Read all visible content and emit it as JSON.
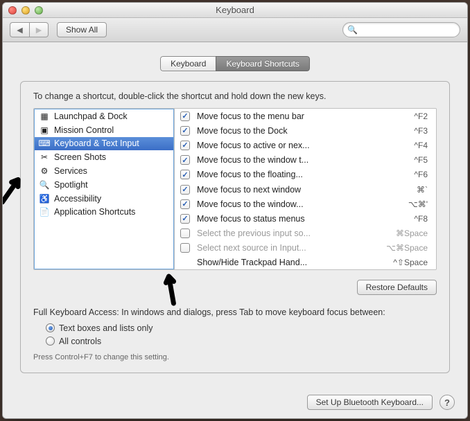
{
  "window": {
    "title": "Keyboard"
  },
  "toolbar": {
    "show_all": "Show All",
    "search_placeholder": ""
  },
  "tabs": {
    "keyboard": "Keyboard",
    "shortcuts": "Keyboard Shortcuts"
  },
  "instruction": "To change a shortcut, double-click the shortcut and hold down the new keys.",
  "categories": [
    {
      "label": "Launchpad & Dock",
      "icon": "launchpad-icon",
      "sel": false
    },
    {
      "label": "Mission Control",
      "icon": "mission-control-icon",
      "sel": false
    },
    {
      "label": "Keyboard & Text Input",
      "icon": "keyboard-icon",
      "sel": true
    },
    {
      "label": "Screen Shots",
      "icon": "screenshots-icon",
      "sel": false
    },
    {
      "label": "Services",
      "icon": "services-icon",
      "sel": false
    },
    {
      "label": "Spotlight",
      "icon": "spotlight-icon",
      "sel": false
    },
    {
      "label": "Accessibility",
      "icon": "accessibility-icon",
      "sel": false
    },
    {
      "label": "Application Shortcuts",
      "icon": "app-shortcuts-icon",
      "sel": false
    }
  ],
  "shortcuts": [
    {
      "on": true,
      "label": "Move focus to the menu bar",
      "keys": "^F2"
    },
    {
      "on": true,
      "label": "Move focus to the Dock",
      "keys": "^F3"
    },
    {
      "on": true,
      "label": "Move focus to active or nex...",
      "keys": "^F4"
    },
    {
      "on": true,
      "label": "Move focus to the window t...",
      "keys": "^F5"
    },
    {
      "on": true,
      "label": "Move focus to the floating...",
      "keys": "^F6"
    },
    {
      "on": true,
      "label": "Move focus to next window",
      "keys": "⌘`"
    },
    {
      "on": true,
      "label": "Move focus to the window...",
      "keys": "⌥⌘'"
    },
    {
      "on": true,
      "label": "Move focus to status menus",
      "keys": "^F8"
    },
    {
      "on": false,
      "label": "Select the previous input so...",
      "keys": "⌘Space",
      "disabled": true
    },
    {
      "on": false,
      "label": "Select next source in Input...",
      "keys": "⌥⌘Space",
      "disabled": true
    },
    {
      "on": null,
      "label": "Show/Hide Trackpad Hand...",
      "keys": "^⇧Space"
    }
  ],
  "restore_defaults": "Restore Defaults",
  "fka": {
    "text": "Full Keyboard Access: In windows and dialogs, press Tab to move keyboard focus between:",
    "opt1": "Text boxes and lists only",
    "opt2": "All controls",
    "note": "Press Control+F7 to change this setting."
  },
  "bluetooth": "Set Up Bluetooth Keyboard...",
  "icons": {
    "launchpad-icon": "▦",
    "mission-control-icon": "▣",
    "keyboard-icon": "⌨",
    "screenshots-icon": "✂",
    "services-icon": "⚙",
    "spotlight-icon": "🔍",
    "accessibility-icon": "♿",
    "app-shortcuts-icon": "📄"
  }
}
